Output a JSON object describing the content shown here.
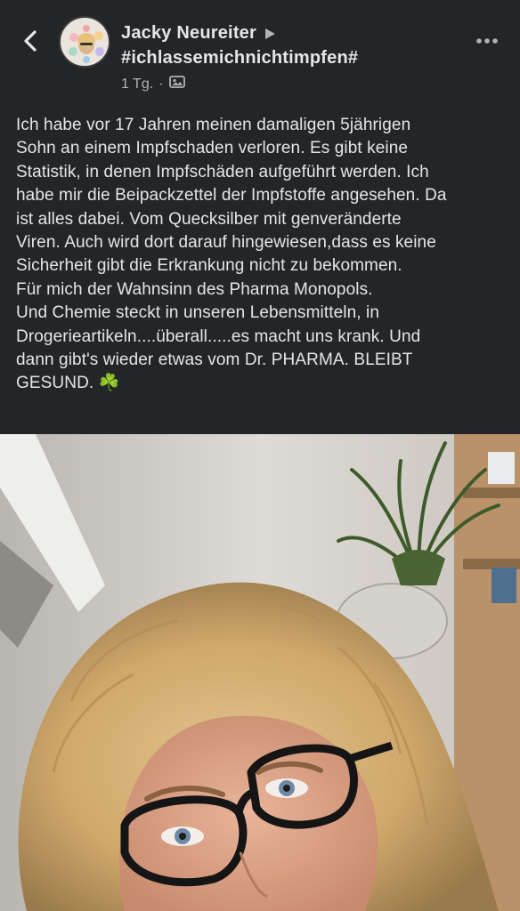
{
  "header": {
    "back_icon": "chevron-left-icon",
    "author_name": "Jacky Neureiter",
    "arrow_icon": "play-arrow-icon",
    "group_name": "#ichlassemichnichtimpfen#",
    "timestamp": "1 Tg.",
    "separator": "·",
    "audience_icon": "photo-audience-icon",
    "more_icon": "more-options-icon"
  },
  "post": {
    "text": "Ich habe vor 17 Jahren meinen damaligen 5jährigen\nSohn an einem Impfschaden verloren. Es gibt keine\nStatistik, in denen Impfschäden aufgeführt werden. Ich\nhabe mir die Beipackzettel der Impfstoffe angesehen. Da\nist alles dabei. Vom Quecksilber mit genveränderte\nViren. Auch wird dort darauf hingewiesen,dass es keine\nSicherheit gibt die Erkrankung nicht zu bekommen.\nFür mich der Wahnsinn des Pharma Monopols.\nUnd Chemie steckt in unseren Lebensmitteln, in\nDrogerieartikeln....überall.....es macht uns krank. Und\ndann gibt's wieder etwas vom Dr. PHARMA. BLEIBT\nGESUND. ☘️"
  },
  "colors": {
    "background": "#242526",
    "text_primary": "#e4e6eb",
    "text_secondary": "#b0b3b8"
  }
}
